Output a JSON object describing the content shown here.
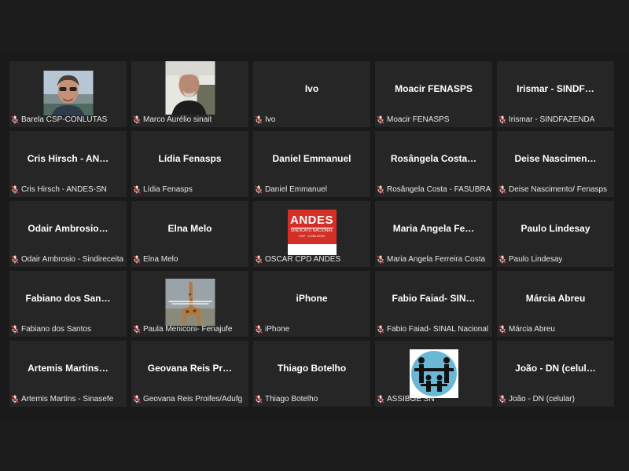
{
  "participants": [
    {
      "center": "",
      "label": "Barela CSP-CONLUTAS",
      "kind": "photo-man1"
    },
    {
      "center": "",
      "label": "Marco Aurélio sinait",
      "kind": "photo-man2"
    },
    {
      "center": "Ivo",
      "label": "Ivo",
      "kind": "name"
    },
    {
      "center": "Moacir FENASPS",
      "label": "Moacir FENASPS",
      "kind": "name"
    },
    {
      "center": "Irismar - SINDF…",
      "label": "Irismar - SINDFAZENDA",
      "kind": "name"
    },
    {
      "center": "Cris Hirsch - AN…",
      "label": "Cris Hirsch - ANDES-SN",
      "kind": "name"
    },
    {
      "center": "Lídia Fenasps",
      "label": "Lídia Fenasps",
      "kind": "name"
    },
    {
      "center": "Daniel Emmanuel",
      "label": "Daniel Emmanuel",
      "kind": "name"
    },
    {
      "center": "Rosângela Costa…",
      "label": "Rosângela Costa - FASUBRA",
      "kind": "name"
    },
    {
      "center": "Deise Nascimen…",
      "label": "Deise Nascimento/ Fenasps",
      "kind": "name"
    },
    {
      "center": "Odair Ambrosio…",
      "label": "Odair Ambrosio - Sindireceita",
      "kind": "name"
    },
    {
      "center": "Elna Melo",
      "label": "Elna Melo",
      "kind": "name"
    },
    {
      "center": "",
      "label": "OSCAR CPD ANDES",
      "kind": "andes"
    },
    {
      "center": "Maria Angela Fe…",
      "label": "Maria Angela Ferreira Costa",
      "kind": "name"
    },
    {
      "center": "Paulo Lindesay",
      "label": "Paulo Lindesay",
      "kind": "name"
    },
    {
      "center": "Fabiano dos San…",
      "label": "Fabiano dos Santos",
      "kind": "name"
    },
    {
      "center": "",
      "label": "Paula Meniconi- Fenajufe",
      "kind": "giraffe"
    },
    {
      "center": "iPhone",
      "label": "iPhone",
      "kind": "name"
    },
    {
      "center": "Fabio Faiad- SIN…",
      "label": "Fabio Faiad- SINAL Nacional",
      "kind": "name"
    },
    {
      "center": "Márcia Abreu",
      "label": "Márcia Abreu",
      "kind": "name"
    },
    {
      "center": "Artemis Martins…",
      "label": "Artemis Martins - Sinasefe",
      "kind": "name"
    },
    {
      "center": "Geovana Reis Pr…",
      "label": "Geovana Reis Proifes/Adufg",
      "kind": "name"
    },
    {
      "center": "Thiago Botelho",
      "label": "Thiago Botelho",
      "kind": "name"
    },
    {
      "center": "",
      "label": "ASSIBGE SN",
      "kind": "assibge"
    },
    {
      "center": "João - DN (celul…",
      "label": "João - DN (celular)",
      "kind": "name"
    }
  ],
  "logos": {
    "andes_title": "ANDES",
    "andes_sub": "SINDICATO NACIONAL",
    "andes_tiny": "CSP - CONLUTAS"
  },
  "colors": {
    "tile_bg": "#262626",
    "muted_mic": "#e0363a"
  },
  "icons": {
    "mic": "muted-mic-icon"
  }
}
